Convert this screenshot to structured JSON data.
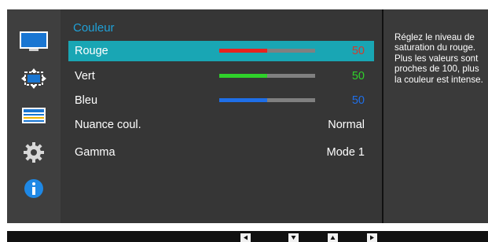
{
  "menu": {
    "title": "Couleur",
    "items": [
      {
        "label": "Rouge",
        "value": "50",
        "level": 0.5,
        "color": "#e8221f",
        "selected": true
      },
      {
        "label": "Vert",
        "value": "50",
        "level": 0.5,
        "color": "#2fd12a",
        "selected": false
      },
      {
        "label": "Bleu",
        "value": "50",
        "level": 0.5,
        "color": "#1f6fe8",
        "selected": false
      },
      {
        "label": "Nuance coul.",
        "value": "Normal"
      },
      {
        "label": "Gamma",
        "value": "Mode 1"
      }
    ]
  },
  "help": {
    "text": "Réglez le niveau de saturation du rouge. Plus les valeurs sont proches de 100, plus la couleur est intense."
  },
  "icons": [
    "monitor-icon",
    "size-position-icon",
    "setup-menu-icon",
    "gear-icon",
    "info-icon"
  ],
  "nav_keys": [
    "left-arrow-key-icon",
    "down-arrow-key-icon",
    "up-arrow-key-icon",
    "right-arrow-key-icon"
  ],
  "colors": {
    "accent": "#19a6b4",
    "title": "#1fa1d8",
    "panel": "#363636",
    "rail": "#3f3f3f",
    "bar_track": "#808080"
  }
}
